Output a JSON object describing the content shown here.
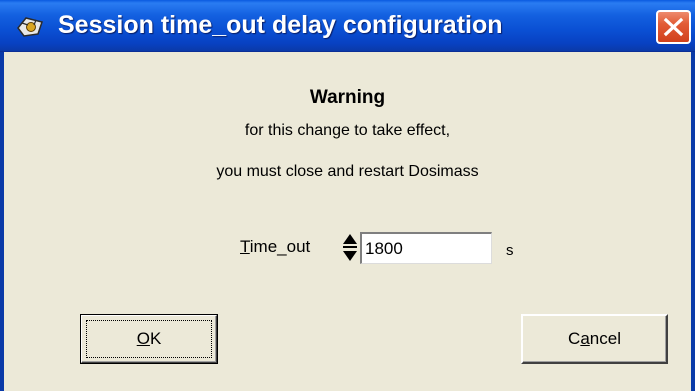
{
  "window": {
    "title": "Session time_out delay configuration"
  },
  "content": {
    "warning_title": "Warning",
    "message_line1": "for this change to take effect,",
    "message_line2": "you must close and restart Dosimass"
  },
  "timeout": {
    "label_mnemonic": "T",
    "label_rest": "ime_out",
    "value": "1800",
    "unit": "s"
  },
  "buttons": {
    "ok_mnemonic": "O",
    "ok_rest": "K",
    "cancel_prefix": "C",
    "cancel_mnemonic": "a",
    "cancel_rest": "ncel"
  },
  "colors": {
    "titlebar": "#0a4fd3",
    "close": "#d1401c",
    "dialog_bg": "#ece9d8"
  },
  "icons": {
    "app": "app-icon",
    "close": "close-icon",
    "spinner": "spinner-updown-icon"
  }
}
